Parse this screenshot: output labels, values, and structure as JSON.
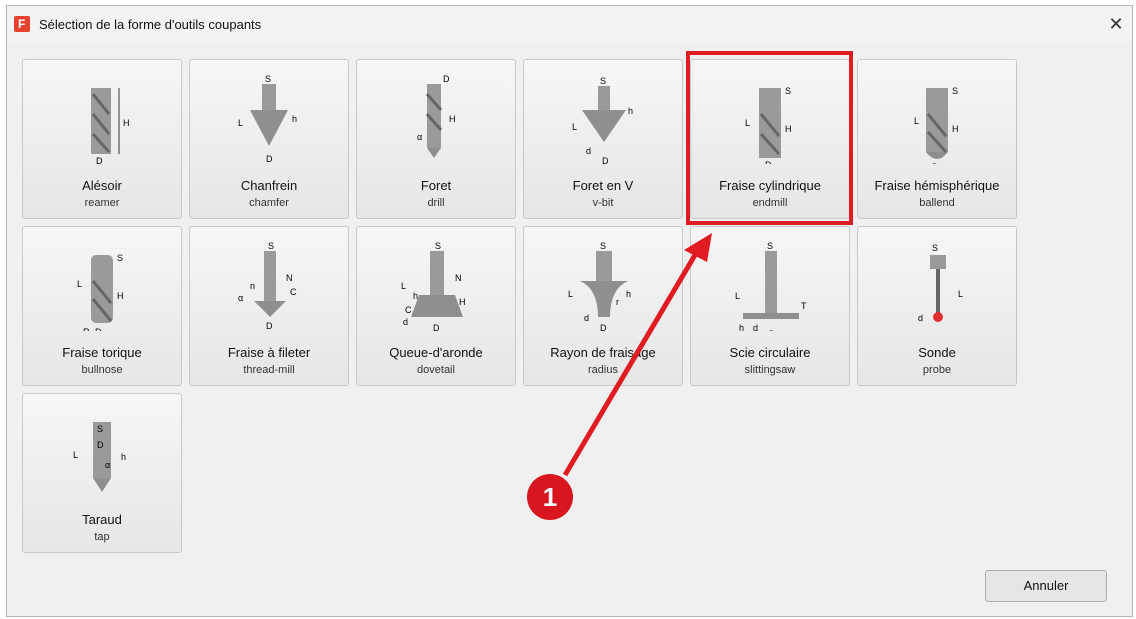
{
  "window": {
    "title": "Sélection de la forme d'outils coupants",
    "close_label": "✕"
  },
  "tools": [
    {
      "name": "Alésoir",
      "sub": "reamer",
      "icon": "reamer-icon"
    },
    {
      "name": "Chanfrein",
      "sub": "chamfer",
      "icon": "chamfer-icon"
    },
    {
      "name": "Foret",
      "sub": "drill",
      "icon": "drill-icon"
    },
    {
      "name": "Foret en V",
      "sub": "v-bit",
      "icon": "v-bit-icon"
    },
    {
      "name": "Fraise cylindrique",
      "sub": "endmill",
      "icon": "endmill-icon"
    },
    {
      "name": "Fraise hémisphérique",
      "sub": "ballend",
      "icon": "ballend-icon"
    },
    {
      "name": "Fraise torique",
      "sub": "bullnose",
      "icon": "bullnose-icon"
    },
    {
      "name": "Fraise à fileter",
      "sub": "thread-mill",
      "icon": "thread-mill-icon"
    },
    {
      "name": "Queue-d'aronde",
      "sub": "dovetail",
      "icon": "dovetail-icon"
    },
    {
      "name": "Rayon de fraisage",
      "sub": "radius",
      "icon": "radius-icon"
    },
    {
      "name": "Scie circulaire",
      "sub": "slittingsaw",
      "icon": "slittingsaw-icon"
    },
    {
      "name": "Sonde",
      "sub": "probe",
      "icon": "probe-icon"
    },
    {
      "name": "Taraud",
      "sub": "tap",
      "icon": "tap-icon"
    }
  ],
  "footer": {
    "cancel_label": "Annuler"
  },
  "annotation": {
    "badge_number": "1",
    "highlight_color": "#e01b22"
  }
}
